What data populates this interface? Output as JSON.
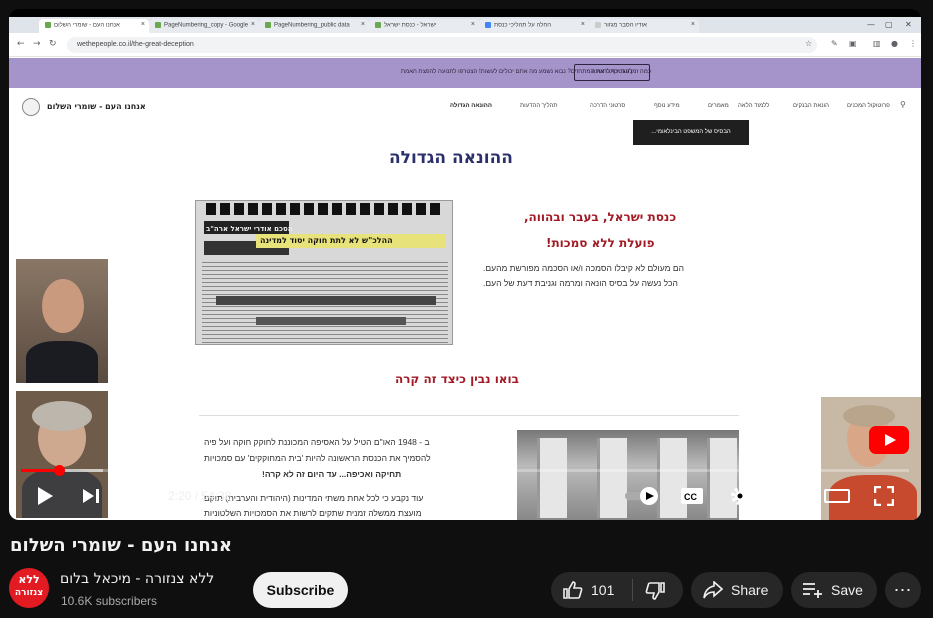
{
  "browser": {
    "tabs": [
      {
        "label": "אנחנו העם - שומרי השלום"
      },
      {
        "label": "PageNumbering_copy - Google"
      },
      {
        "label": "PageNumbering_public data"
      },
      {
        "label": "ישראל - כנסת ישראל"
      },
      {
        "label": "החלה על תהליכי כנסת"
      },
      {
        "label": "אודיו הסבר מגזור"
      }
    ],
    "url": "wethepeople.co.il/the-great-deception",
    "window_controls": [
      "—",
      "▢",
      "✕"
    ]
  },
  "site": {
    "banner_text": "כמה זמן עוד יכתרו את המתחזים? נבוא נשמע מה אתם יכולים לעשות! הצטרפו לתנועה להפצת האמת",
    "banner_button": "להצטרף לתנועה",
    "logo_text": "אנחנו העם - שומרי השלום",
    "menu": [
      "ההונאה הגדולה",
      "תהליך ההדעות",
      "סרטוני הדרכה",
      "מידע נוסף",
      "מאמרים",
      "ללמוד הלאה",
      "הונאת הבנקים",
      "פרוטוקול המכנים"
    ],
    "tooltip": "הבסיס של המשפט הבינלאומי...",
    "page_title": "ההונאה הגדולה",
    "paper_headline": "ההלכ\"ש לא לתת חוקה יסוד למדינה",
    "paper_top": "הסכם אודרי ישראל ארה\"ב",
    "red_line_1": "כנסת ישראל, בעבר ובהווה,",
    "red_line_2": "פועלת ללא סמכות!",
    "body_line_1": "הם מעולם לא קיבלו הסמכה ו/או הסכמה מפורשת מהעם.",
    "body_line_2": "הכל נעשה על בסיס הונאה ומרמה וגניבת דעת של העם.",
    "subhead": "בואו נבין כיצד זה קרה",
    "lower_lines": [
      "ב - 1948 האו\"ם הטיל על האסיפה המכוננת לחוקק חוקה ועל פיה",
      "להסמיך את הכנסת הראשונה להיות 'בית המחוקקים' עם סמכויות",
      "תחיקה ואכיפה... עד היום זה לא קרה!",
      "עוד נקבע כי לכל אחת משתי המדינות (היהודית והערבית) תוקם",
      "מועצת ממשלה זמנית שתקים לרשות את הסמכויות השלטוניות"
    ]
  },
  "player": {
    "current_time": "2:20",
    "duration": "54:38",
    "progress": 0.043,
    "time_separator": "/"
  },
  "video": {
    "title": "אנחנו העם - שומרי השלום",
    "channel_name": "ללא צנזורה - מיכאל בלום",
    "avatar_text": "ללא\nצנזורה",
    "subscribers": "10.6K subscribers",
    "subscribe_label": "Subscribe",
    "likes": "101",
    "share_label": "Share",
    "save_label": "Save"
  },
  "colors": {
    "accent": "#ff0000",
    "banner": "#a594c9",
    "title_navy": "#2b2f6b",
    "headline_red": "#a11a24"
  }
}
